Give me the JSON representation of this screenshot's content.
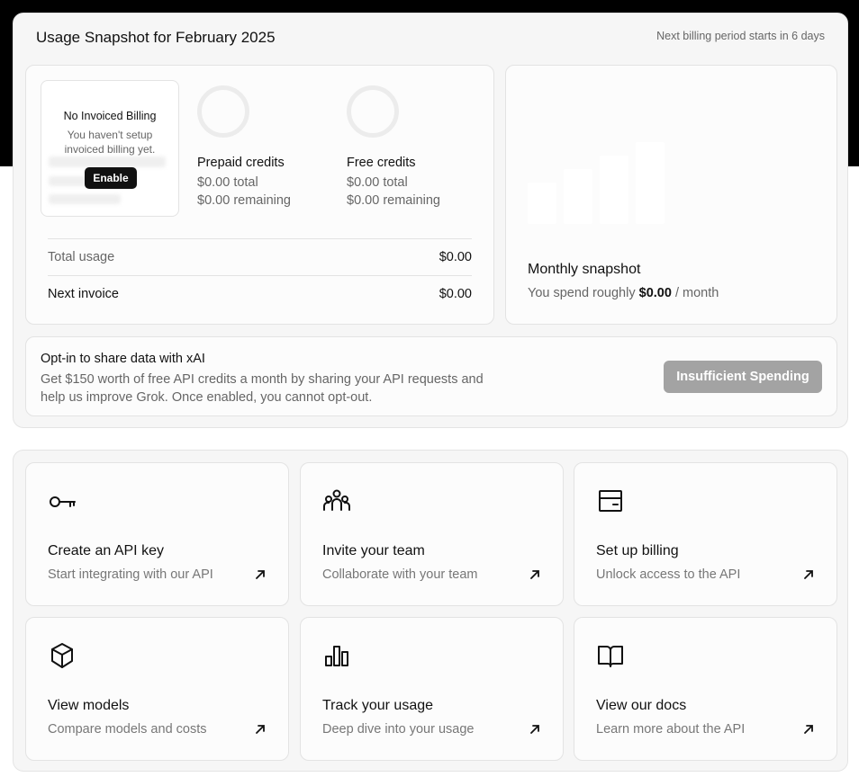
{
  "usage": {
    "title": "Usage Snapshot for February 2025",
    "billing_note": "Next billing period starts in 6 days",
    "invoiced": {
      "title": "No Invoiced Billing",
      "text": "You haven't setup invoiced billing yet.",
      "enable_label": "Enable"
    },
    "prepaid": {
      "label": "Prepaid credits",
      "total": "$0.00 total",
      "remaining": "$0.00 remaining"
    },
    "free": {
      "label": "Free credits",
      "total": "$0.00 total",
      "remaining": "$0.00 remaining"
    },
    "total_usage": {
      "label": "Total usage",
      "value": "$0.00"
    },
    "next_invoice": {
      "label": "Next invoice",
      "value": "$0.00"
    }
  },
  "snapshot": {
    "title": "Monthly snapshot",
    "prefix": "You spend roughly",
    "amount": "$0.00",
    "suffix": "/ month"
  },
  "optin": {
    "title": "Opt-in to share data with xAI",
    "text": "Get $150 worth of free API credits a month by sharing your API requests and help us improve Grok. Once enabled, you cannot opt-out.",
    "button_label": "Insufficient Spending"
  },
  "actions": [
    {
      "title": "Create an API key",
      "subtitle": "Start integrating with our API",
      "icon": "key-icon"
    },
    {
      "title": "Invite your team",
      "subtitle": "Collaborate with your team",
      "icon": "team-icon"
    },
    {
      "title": "Set up billing",
      "subtitle": "Unlock access to the API",
      "icon": "billing-icon"
    },
    {
      "title": "View models",
      "subtitle": "Compare models and costs",
      "icon": "cube-icon"
    },
    {
      "title": "Track your usage",
      "subtitle": "Deep dive into your usage",
      "icon": "bar-chart-icon"
    },
    {
      "title": "View our docs",
      "subtitle": "Learn more about the API",
      "icon": "book-icon"
    }
  ],
  "colors": {
    "disabled_button": "#a3a3a3",
    "enable_button": "#111111",
    "panel_bg": "#f6f6f6"
  }
}
